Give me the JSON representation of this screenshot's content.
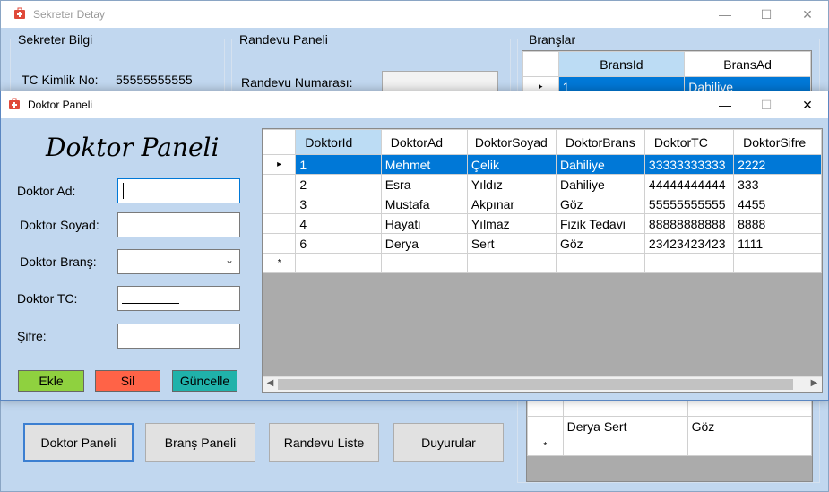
{
  "back_window": {
    "title": "Sekreter Detay",
    "min_icon": "minimize-icon",
    "max_icon": "maximize-icon",
    "close_icon": "close-icon",
    "sekreter_group": {
      "title": "Sekreter Bilgi",
      "tc_label": "TC Kimlik No:",
      "tc_value": "55555555555"
    },
    "randevu_group": {
      "title": "Randevu Paneli",
      "numara_label": "Randevu Numarası:"
    },
    "branslar_group": {
      "title": "Branşlar",
      "columns": [
        "BransId",
        "BransAd"
      ],
      "rows": [
        {
          "id": "1",
          "ad": "Dahiliye"
        }
      ]
    },
    "bottom_grid": {
      "rows": [
        {
          "name": "Derya Sert",
          "brans": "Göz"
        }
      ]
    },
    "buttons": {
      "doktor_paneli": "Doktor Paneli",
      "brans_paneli": "Branş Paneli",
      "randevu_liste": "Randevu Liste",
      "duyurular": "Duyurular"
    }
  },
  "front_window": {
    "title": "Doktor Paneli",
    "heading": "Doktor Paneli",
    "labels": {
      "ad": "Doktor Ad:",
      "soyad": "Doktor Soyad:",
      "brans": "Doktor Branş:",
      "tc": "Doktor TC:",
      "sifre": "Şifre:"
    },
    "buttons": {
      "ekle": "Ekle",
      "sil": "Sil",
      "guncelle": "Güncelle"
    },
    "colors": {
      "ekle": "#8fd13f",
      "sil": "#ff6347",
      "guncelle": "#20b2aa"
    },
    "grid": {
      "columns": [
        "DoktorId",
        "DoktorAd",
        "DoktorSoyad",
        "DoktorBrans",
        "DoktorTC",
        "DoktorSifre"
      ],
      "rows": [
        [
          "1",
          "Mehmet",
          "Çelik",
          "Dahiliye",
          "33333333333",
          "2222"
        ],
        [
          "2",
          "Esra",
          "Yıldız",
          "Dahiliye",
          "44444444444",
          "333"
        ],
        [
          "3",
          "Mustafa",
          "Akpınar",
          "Göz",
          "55555555555",
          "4455"
        ],
        [
          "4",
          "Hayati",
          "Yılmaz",
          "Fizik Tedavi",
          "88888888888",
          "8888"
        ],
        [
          "6",
          "Derya",
          "Sert",
          "Göz",
          "23423423423",
          "1111"
        ]
      ],
      "selected_row_marker": "▸",
      "new_row_marker": "*"
    }
  }
}
